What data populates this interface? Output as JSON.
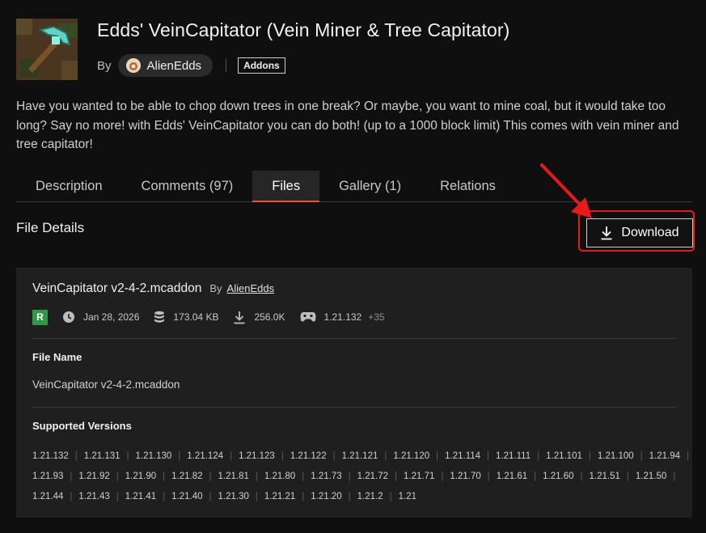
{
  "project": {
    "title": "Edds' VeinCapitator (Vein Miner & Tree Capitator)",
    "by_label": "By",
    "author": "AlienEdds",
    "tag": "Addons",
    "summary": "Have you wanted to be able to chop down trees in one break? Or maybe, you want to mine coal, but it would take too long? Say no more! with Edds' VeinCapitator you can do both! (up to a 1000 block limit) This comes with vein miner and tree capitator!"
  },
  "tabs": [
    {
      "label": "Description",
      "active": false
    },
    {
      "label": "Comments (97)",
      "active": false
    },
    {
      "label": "Files",
      "active": true
    },
    {
      "label": "Gallery (1)",
      "active": false
    },
    {
      "label": "Relations",
      "active": false
    }
  ],
  "file_details": {
    "heading": "File Details",
    "download_label": "Download",
    "file_title": "VeinCapitator v2-4-2.mcaddon",
    "by_label": "By",
    "author": "AlienEdds",
    "release_badge": "R",
    "date": "Jan 28, 2026",
    "size": "173.04 KB",
    "downloads": "256.0K",
    "game_version": "1.21.132",
    "extra_versions": "+35",
    "file_name_label": "File Name",
    "file_name": "VeinCapitator v2-4-2.mcaddon",
    "supported_versions_label": "Supported Versions",
    "supported_versions": [
      [
        "1.21.132",
        "1.21.131",
        "1.21.130",
        "1.21.124",
        "1.21.123",
        "1.21.122",
        "1.21.121",
        "1.21.120",
        "1.21.114",
        "1.21.111",
        "1.21.101",
        "1.21.100",
        "1.21.94"
      ],
      [
        "1.21.93",
        "1.21.92",
        "1.21.90",
        "1.21.82",
        "1.21.81",
        "1.21.80",
        "1.21.73",
        "1.21.72",
        "1.21.71",
        "1.21.70",
        "1.21.61",
        "1.21.60",
        "1.21.51",
        "1.21.50"
      ],
      [
        "1.21.44",
        "1.21.43",
        "1.21.41",
        "1.21.40",
        "1.21.30",
        "1.21.21",
        "1.21.20",
        "1.21.2",
        "1.21"
      ]
    ]
  },
  "colors": {
    "accent_tab": "#e8553a",
    "highlight_box": "#e51b1b",
    "release_badge": "#2e9a45"
  }
}
